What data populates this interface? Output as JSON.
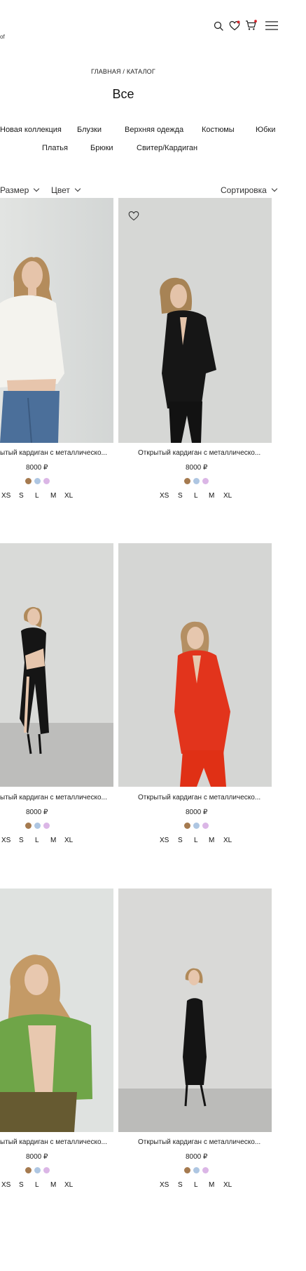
{
  "header": {
    "logo_fragment": "of",
    "icons": [
      "search-icon",
      "heart-icon",
      "cart-icon",
      "menu-icon"
    ],
    "badge_color": "#d6232a"
  },
  "breadcrumb": "ГЛАВНАЯ / КАТАЛОГ",
  "title": "Все",
  "categories": [
    "Новая коллекция",
    "Блузки",
    "Верхняя одежда",
    "Костюмы",
    "Юбки",
    "Платья",
    "Брюки",
    "Свитер/Кардиган"
  ],
  "filters": {
    "size_label": "Размер",
    "color_label": "Цвет",
    "sort_label": "Сортировка"
  },
  "products": [
    {
      "name": "ытый кардиган с металлическо...",
      "price": "8000 ₽",
      "colors": [
        "#a57a4f",
        "#aec6e2",
        "#dbb6e6"
      ],
      "sizes": [
        "XS",
        "S",
        "L",
        "M",
        "XL"
      ],
      "photo": "woman in white shirt and blue jeans"
    },
    {
      "name": "Открытый кардиган с металлическо...",
      "price": "8000 ₽",
      "colors": [
        "#a57a4f",
        "#aec6e2",
        "#dbb6e6"
      ],
      "sizes": [
        "XS",
        "S",
        "L",
        "M",
        "XL"
      ],
      "photo": "woman in black suit"
    },
    {
      "name": "ытый кардиган с металлическо...",
      "price": "8000 ₽",
      "colors": [
        "#a57a4f",
        "#aec6e2",
        "#dbb6e6"
      ],
      "sizes": [
        "XS",
        "S",
        "L",
        "M",
        "XL"
      ],
      "photo": "woman in black cut-out dress"
    },
    {
      "name": "Открытый кардиган с металлическо...",
      "price": "8000 ₽",
      "colors": [
        "#a57a4f",
        "#aec6e2",
        "#dbb6e6"
      ],
      "sizes": [
        "XS",
        "S",
        "L",
        "M",
        "XL"
      ],
      "photo": "woman in red suit"
    },
    {
      "name": "ытый кардиган с металлическо...",
      "price": "8000 ₽",
      "colors": [
        "#a57a4f",
        "#aec6e2",
        "#dbb6e6"
      ],
      "sizes": [
        "XS",
        "S",
        "L",
        "M",
        "XL"
      ],
      "photo": "woman in green cardigan"
    },
    {
      "name": "Открытый кардиган с металлическо...",
      "price": "8000 ₽",
      "colors": [
        "#a57a4f",
        "#aec6e2",
        "#dbb6e6"
      ],
      "sizes": [
        "XS",
        "S",
        "L",
        "M",
        "XL"
      ],
      "photo": "woman in black slip dress"
    }
  ]
}
